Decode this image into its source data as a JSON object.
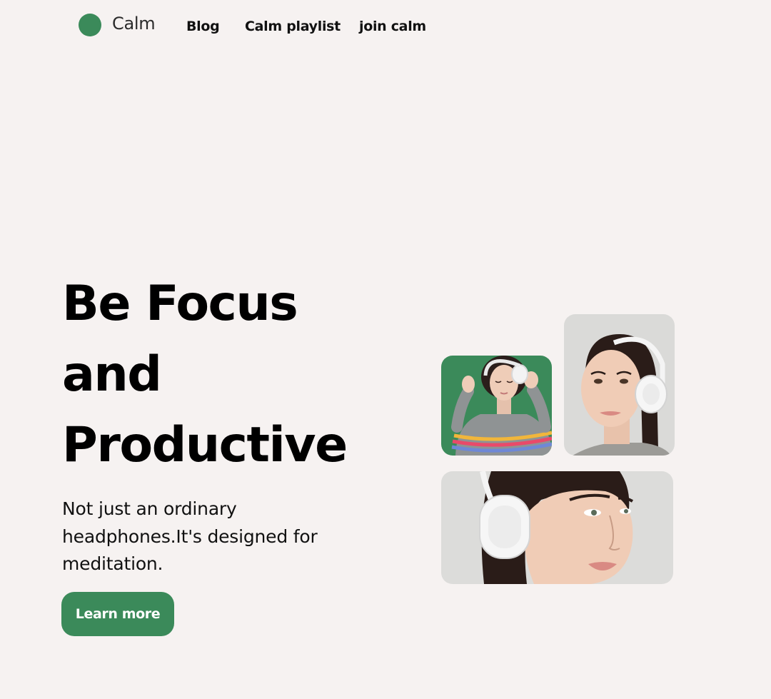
{
  "header": {
    "logo_text": "Calm",
    "nav": [
      {
        "label": "Blog"
      },
      {
        "label": "Calm playlist"
      },
      {
        "label": "join calm"
      }
    ]
  },
  "hero": {
    "title_lines": [
      "Be Focus",
      "and",
      "Productive"
    ],
    "subtitle": "Not just an ordinary headphones.It's designed for meditation.",
    "cta_label": "Learn more"
  },
  "colors": {
    "accent": "#3b8a5a",
    "background": "#f6f2f1",
    "text": "#000000"
  }
}
